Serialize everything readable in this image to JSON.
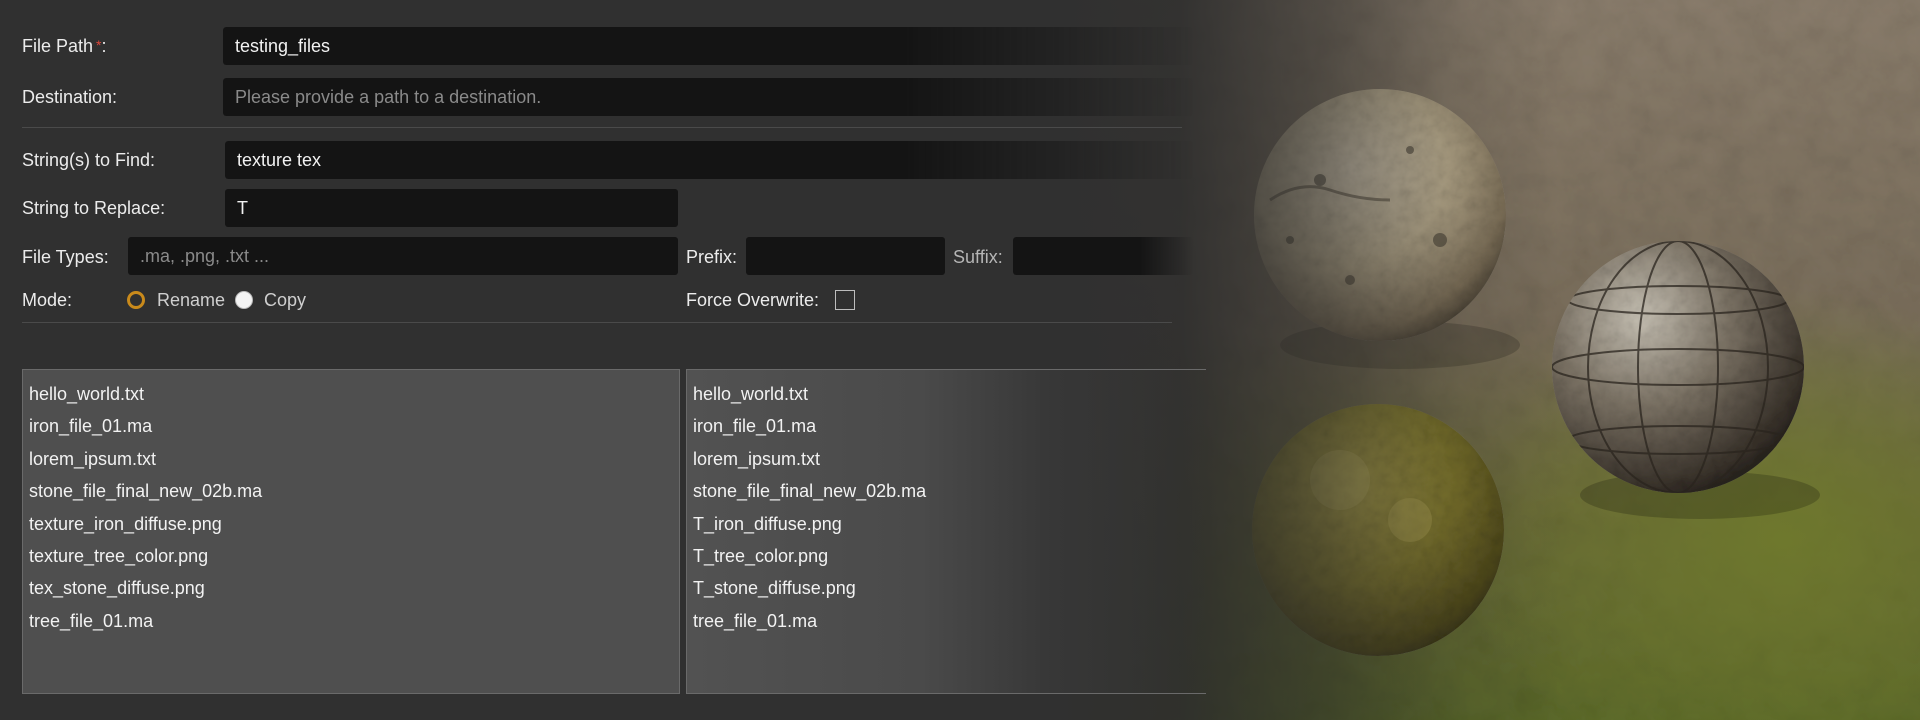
{
  "form": {
    "file_path_label": "File Path",
    "required_marker": "*",
    "file_path_colon": ":",
    "file_path_value": "testing_files",
    "destination_label": "Destination:",
    "destination_placeholder": "Please provide a path to a destination.",
    "strings_to_find_label": "String(s) to Find:",
    "strings_to_find_value": "texture tex",
    "string_to_replace_label": "String to Replace:",
    "string_to_replace_value": "T",
    "file_types_label": "File Types:",
    "file_types_placeholder": ".ma, .png, .txt ...",
    "prefix_label": "Prefix:",
    "prefix_value": "",
    "suffix_label": "Suffix:",
    "suffix_value": "",
    "mode_label": "Mode:",
    "mode_options": [
      "Rename",
      "Copy"
    ],
    "mode_selected": "Rename",
    "force_overwrite_label": "Force Overwrite:",
    "force_overwrite_checked": false
  },
  "source_files": [
    "hello_world.txt",
    "iron_file_01.ma",
    "lorem_ipsum.txt",
    "stone_file_final_new_02b.ma",
    "texture_iron_diffuse.png",
    "texture_tree_color.png",
    "tex_stone_diffuse.png",
    "tree_file_01.ma"
  ],
  "result_files": [
    "hello_world.txt",
    "iron_file_01.ma",
    "lorem_ipsum.txt",
    "stone_file_final_new_02b.ma",
    "T_iron_diffuse.png",
    "T_tree_color.png",
    "T_stone_diffuse.png",
    "tree_file_01.ma"
  ],
  "colors": {
    "accent_radio": "#c98a1b",
    "required": "#e0453a",
    "field_bg": "#141414"
  },
  "decor": {
    "materials": [
      "stone",
      "metal-panel",
      "moss"
    ]
  }
}
